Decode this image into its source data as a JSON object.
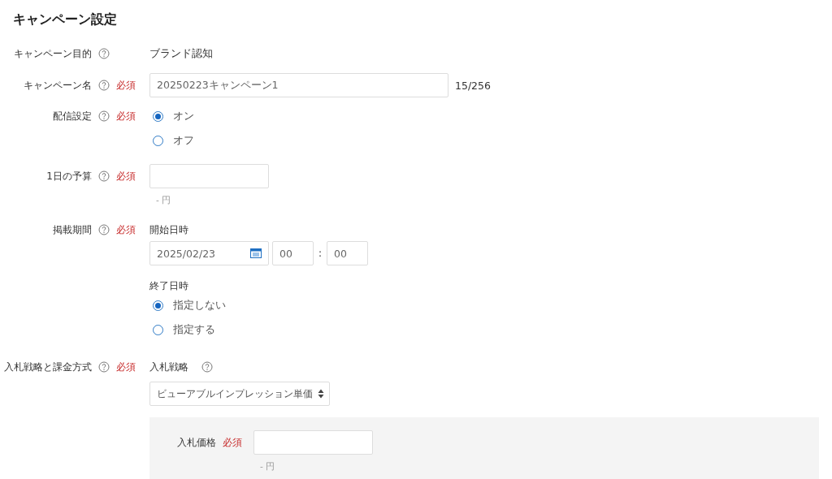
{
  "title": "キャンペーン設定",
  "rows": [
    {
      "kind": "text",
      "label": "キャンペーン目的",
      "help": true,
      "value": "ブランド認知"
    },
    {
      "kind": "textfield",
      "label": "キャンペーン名",
      "help": true,
      "required_label": "必須",
      "value": "20250223キャンペーン1",
      "counter": "15/256"
    },
    {
      "kind": "radio",
      "label": "配信設定",
      "help": true,
      "required_label": "必須",
      "options": [
        {
          "label": "オン",
          "selected": true
        },
        {
          "label": "オフ",
          "selected": false
        }
      ]
    },
    {
      "kind": "amount",
      "label": "1日の予算",
      "help": true,
      "required_label": "必須",
      "unit_hint": "- 円"
    },
    {
      "kind": "period",
      "label": "掲載期間",
      "help": true,
      "required_label": "必須",
      "start": {
        "label": "開始日時",
        "date": "2025/02/23",
        "hour": "00",
        "separator": ":",
        "minute": "00"
      },
      "end": {
        "label": "終了日時",
        "options": [
          {
            "label": "指定しない",
            "selected": true
          },
          {
            "label": "指定する",
            "selected": false
          }
        ]
      }
    },
    {
      "kind": "bidding",
      "label": "入札戦略と課金方式",
      "help": true,
      "required_label": "必須",
      "strategy": {
        "label": "入札戦略",
        "help": true,
        "value": "ビューアブルインプレッション単価"
      },
      "price": {
        "label": "入札価格",
        "required_label": "必須",
        "unit_hint": "- 円"
      }
    }
  ]
}
